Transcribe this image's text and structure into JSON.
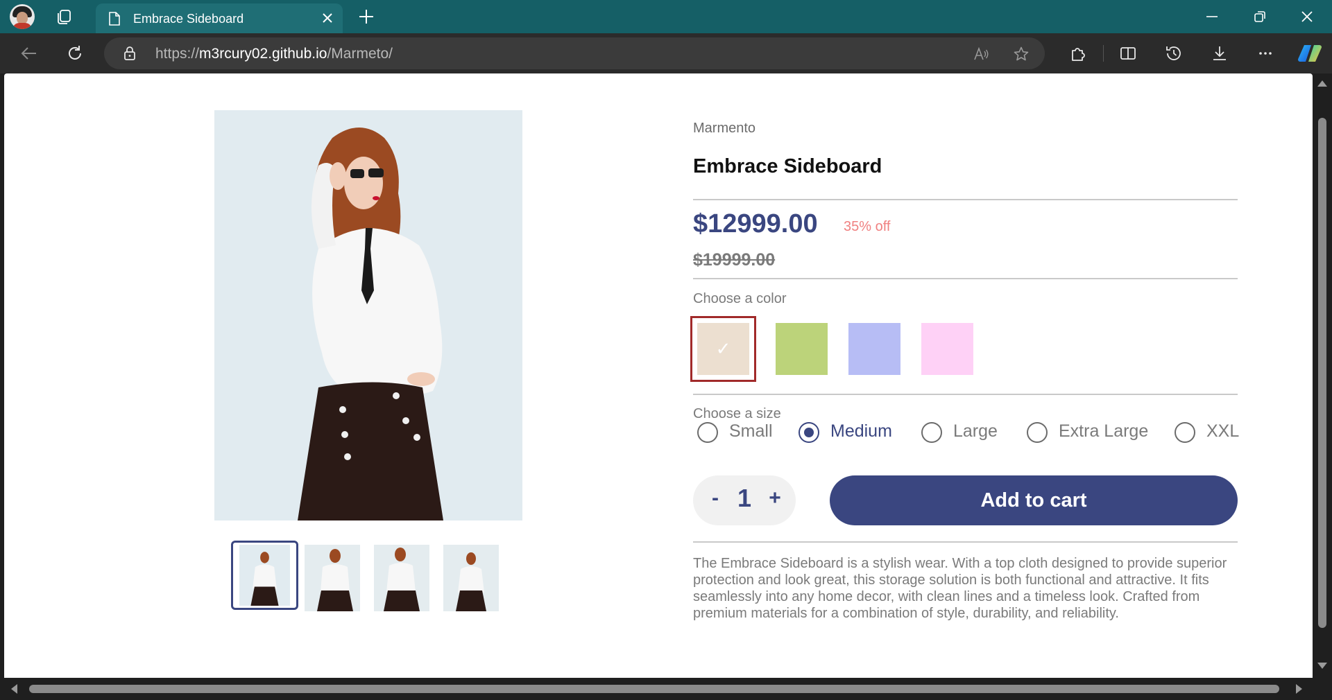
{
  "browser": {
    "tab_title": "Embrace Sideboard",
    "url_prefix": "https://",
    "url_host": "m3rcury02.github.io",
    "url_path": "/Marmeto/"
  },
  "product": {
    "brand": "Marmento",
    "title": "Embrace Sideboard",
    "price": "$12999.00",
    "discount": "35% off",
    "compare_price": "$19999.00",
    "color_label": "Choose a color",
    "colors": [
      {
        "hex": "#ecdfd0",
        "selected": true
      },
      {
        "hex": "#bcd37a",
        "selected": false
      },
      {
        "hex": "#b7bdf5",
        "selected": false
      },
      {
        "hex": "#fed1f6",
        "selected": false
      }
    ],
    "check_mark": "✓",
    "size_label": "Choose a size",
    "sizes": [
      "Small",
      "Medium",
      "Large",
      "Extra Large",
      "XXL"
    ],
    "selected_size": "Medium",
    "quantity": {
      "minus": "-",
      "value": "1",
      "plus": "+"
    },
    "add_to_cart": "Add to cart",
    "description": "The Embrace Sideboard is a stylish wear. With a top cloth designed to provide superior protection and look great, this storage solution is both functional and attractive. It fits seamlessly into any home decor, with clean lines and a timeless look. Crafted from premium materials for a combination of style, durability, and reliability."
  },
  "colors": {
    "accent": "#3a4680",
    "discount": "#f08080",
    "selected_border": "#a12a2a",
    "titlebar": "#155f66"
  }
}
